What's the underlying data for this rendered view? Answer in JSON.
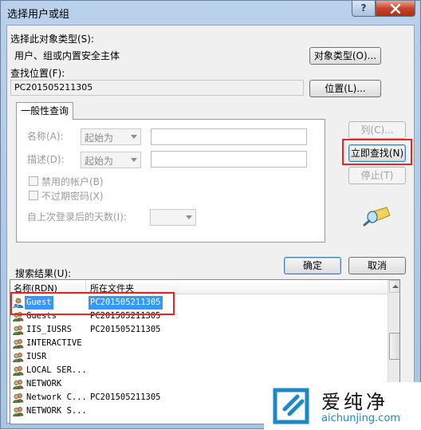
{
  "window": {
    "title": "选择用户或组",
    "help_button": "?",
    "close_button": "X"
  },
  "object_type": {
    "label": "选择此对象类型(S):",
    "value": "用户、组或内置安全主体",
    "button": "对象类型(O)..."
  },
  "location": {
    "label": "查找位置(F):",
    "value": "PC201505211305",
    "button": "位置(L)..."
  },
  "general_query": {
    "tab_label": "一般性查询",
    "name_label": "名称(A):",
    "name_mode": "起始为",
    "description_label": "描述(D):",
    "description_mode": "起始为",
    "disabled_accounts_label": "禁用的帐户(B)",
    "non_expiring_password_label": "不过期密码(X)",
    "days_since_logon_label": "自上次登录后的天数(I):"
  },
  "side_buttons": {
    "columns": "列(C)...",
    "find_now": "立即查找(N)",
    "stop": "停止(T)"
  },
  "dialog_buttons": {
    "ok": "确定",
    "cancel": "取消"
  },
  "results": {
    "label": "搜索结果(U):",
    "columns": [
      "名称(RDN)",
      "所在文件夹"
    ],
    "rows": [
      {
        "name": "Guest",
        "folder": "PC201505211305",
        "icon": "user-icon",
        "selected": true
      },
      {
        "name": "Guests",
        "folder": "PC201505211305",
        "icon": "group-icon"
      },
      {
        "name": "IIS_IUSRS",
        "folder": "PC201505211305",
        "icon": "group-icon"
      },
      {
        "name": "INTERACTIVE",
        "folder": "",
        "icon": "group-icon"
      },
      {
        "name": "IUSR",
        "folder": "",
        "icon": "group-icon"
      },
      {
        "name": "LOCAL SER...",
        "folder": "",
        "icon": "group-icon"
      },
      {
        "name": "NETWORK",
        "folder": "",
        "icon": "group-icon"
      },
      {
        "name": "Network C...",
        "folder": "PC201505211305",
        "icon": "group-icon"
      },
      {
        "name": "NETWORK S...",
        "folder": "",
        "icon": "group-icon"
      }
    ]
  },
  "watermark": {
    "title": "爱纯净",
    "url": "aichunjing.com"
  },
  "colors": {
    "highlight": "#e52623",
    "selection": "#3399ff",
    "watermark_blue": "#1b89c8"
  }
}
